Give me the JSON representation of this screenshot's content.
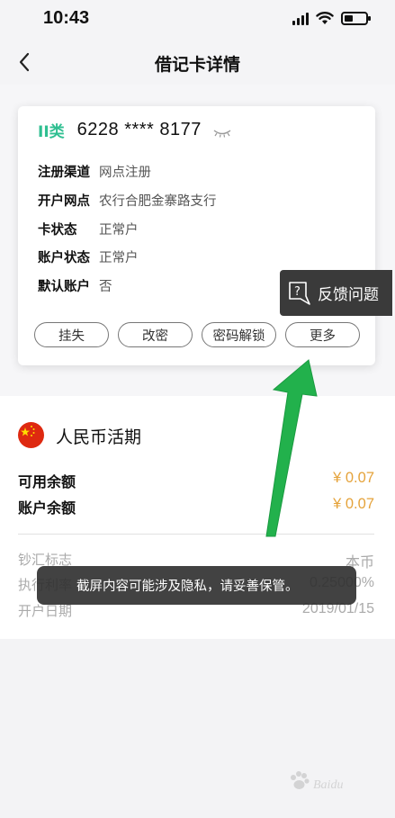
{
  "status_bar": {
    "time": "10:43"
  },
  "nav": {
    "title": "借记卡详情"
  },
  "card": {
    "type_label": "II类",
    "number": "6228 **** 8177",
    "info": [
      {
        "label": "注册渠道",
        "value": "网点注册"
      },
      {
        "label": "开户网点",
        "value": "农行合肥金寨路支行"
      },
      {
        "label": "卡状态",
        "value": "正常户"
      },
      {
        "label": "账户状态",
        "value": "正常户"
      },
      {
        "label": "默认账户",
        "value": "否"
      }
    ],
    "buttons": [
      "挂失",
      "改密",
      "密码解锁",
      "更多"
    ]
  },
  "feedback": {
    "label": "反馈问题"
  },
  "account": {
    "title": "人民币活期",
    "balances": [
      {
        "label": "可用余额",
        "value": "¥ 0.07"
      },
      {
        "label": "账户余额",
        "value": "¥ 0.07"
      }
    ],
    "details": [
      {
        "label": "钞汇标志",
        "value": "本币"
      },
      {
        "label": "执行利率",
        "value": "0.25000%"
      },
      {
        "label": "开户日期",
        "value": "2019/01/15"
      }
    ]
  },
  "toast": {
    "message": "截屏内容可能涉及隐私，请妥善保管。"
  },
  "watermark": {
    "text": "Baidu"
  },
  "colors": {
    "accent_green": "#2fbf91",
    "amount_orange": "#e5a33b",
    "arrow_green": "#22b14c"
  }
}
